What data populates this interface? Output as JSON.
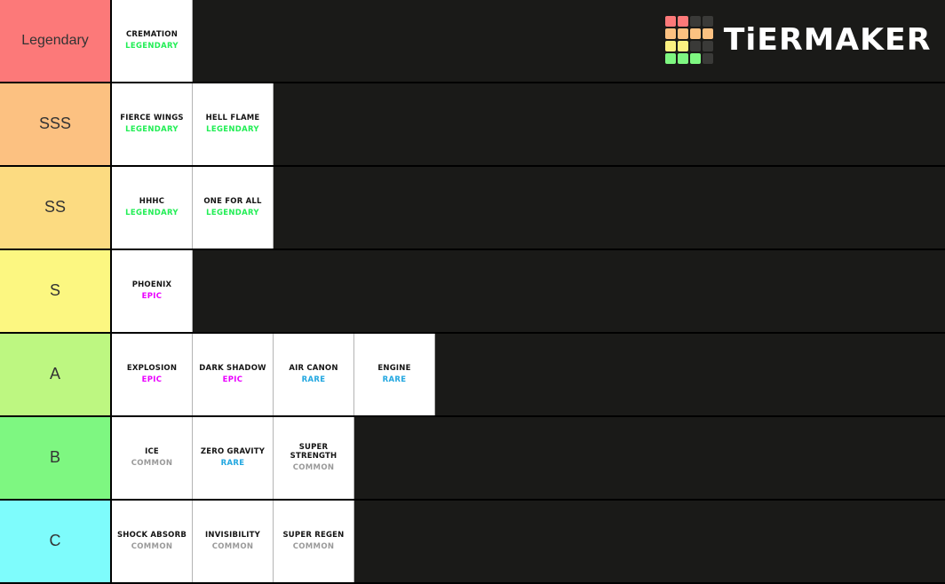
{
  "app": {
    "title": "TierMaker",
    "logo_text": "TiERMAKER",
    "background_color": "#1a1a18"
  },
  "logo_grid": {
    "name": "tiermaker-logo-grid",
    "cells": [
      "#fc7979",
      "#fc7979",
      "#3a3a38",
      "#3a3a38",
      "#fcc181",
      "#fcc181",
      "#fcc181",
      "#fcc181",
      "#fcf181",
      "#fcf181",
      "#3a3a38",
      "#3a3a38",
      "#7ef781",
      "#7ef781",
      "#7ef781",
      "#3a3a38"
    ]
  },
  "rarity_colors": {
    "LEGENDARY": "#22ee55",
    "EPIC": "#ea00ff",
    "RARE": "#22a7e0",
    "COMMON": "#9a9a9a"
  },
  "tiers": [
    {
      "label": "Legendary",
      "color": "#fc7979",
      "items": [
        {
          "name": "CREMATION",
          "rarity": "LEGENDARY"
        }
      ]
    },
    {
      "label": "SSS",
      "color": "#fcc181",
      "items": [
        {
          "name": "FIERCE WINGS",
          "rarity": "LEGENDARY"
        },
        {
          "name": "HELL FLAME",
          "rarity": "LEGENDARY"
        }
      ]
    },
    {
      "label": "SS",
      "color": "#fcdb81",
      "items": [
        {
          "name": "HHHC",
          "rarity": "LEGENDARY"
        },
        {
          "name": "ONE FOR ALL",
          "rarity": "LEGENDARY"
        }
      ]
    },
    {
      "label": "S",
      "color": "#fcf781",
      "items": [
        {
          "name": "PHOENIX",
          "rarity": "EPIC"
        }
      ]
    },
    {
      "label": "A",
      "color": "#bdf781",
      "items": [
        {
          "name": "EXPLOSION",
          "rarity": "EPIC"
        },
        {
          "name": "DARK SHADOW",
          "rarity": "EPIC"
        },
        {
          "name": "AIR CANON",
          "rarity": "RARE"
        },
        {
          "name": "ENGINE",
          "rarity": "RARE"
        }
      ]
    },
    {
      "label": "B",
      "color": "#7ef781",
      "items": [
        {
          "name": "ICE",
          "rarity": "COMMON"
        },
        {
          "name": "ZERO GRAVITY",
          "rarity": "RARE"
        },
        {
          "name": "SUPER STRENGTH",
          "rarity": "COMMON"
        }
      ]
    },
    {
      "label": "C",
      "color": "#7efcfc",
      "items": [
        {
          "name": "SHOCK ABSORB",
          "rarity": "COMMON"
        },
        {
          "name": "INVISIBILITY",
          "rarity": "COMMON"
        },
        {
          "name": "SUPER REGEN",
          "rarity": "COMMON"
        }
      ]
    }
  ]
}
